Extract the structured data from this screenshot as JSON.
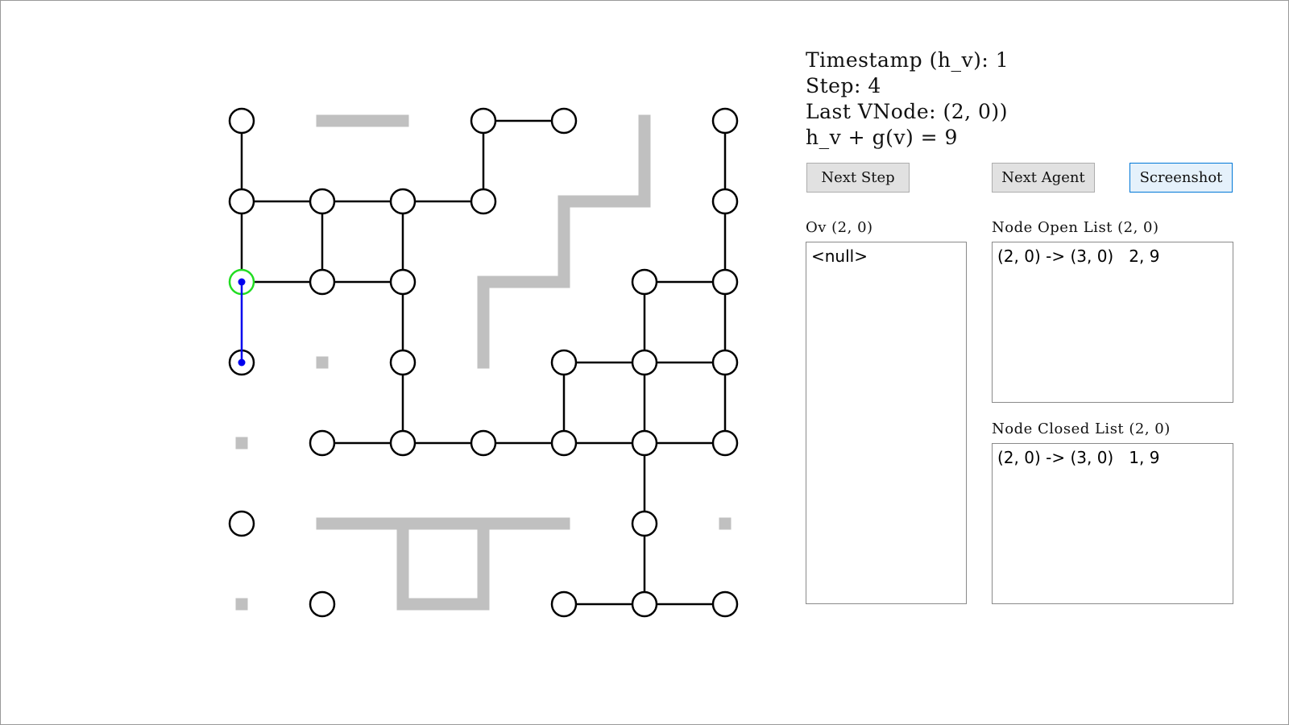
{
  "info": {
    "timestamp": "Timestamp (h_v): 1",
    "step": "Step: 4",
    "last_vnode": "Last VNode: (2, 0))",
    "hv_gv": "h_v + g(v) = 9"
  },
  "buttons": {
    "next_step": "Next Step",
    "next_agent": "Next Agent",
    "screenshot": "Screenshot"
  },
  "ov_list": {
    "label": "Ov (2, 0)",
    "items": [
      "<null>"
    ]
  },
  "open_list": {
    "label": "Node Open List (2, 0)",
    "items": [
      "(2, 0) -> (3, 0)   2, 9"
    ]
  },
  "closed_list": {
    "label": "Node Closed List (2, 0)",
    "items": [
      "(2, 0) -> (3, 0)   1, 9"
    ]
  },
  "colors": {
    "node_stroke": "#000000",
    "edge": "#000000",
    "wall": "#c0c0c0",
    "current_node_ring": "#22dd22",
    "path": "#0000ee"
  },
  "grid": {
    "rows": 7,
    "cols": 7,
    "nodes": [
      [
        0,
        0
      ],
      [
        0,
        3
      ],
      [
        0,
        4
      ],
      [
        0,
        6
      ],
      [
        1,
        0
      ],
      [
        1,
        1
      ],
      [
        1,
        2
      ],
      [
        1,
        3
      ],
      [
        1,
        6
      ],
      [
        2,
        0
      ],
      [
        2,
        1
      ],
      [
        2,
        2
      ],
      [
        2,
        5
      ],
      [
        2,
        6
      ],
      [
        3,
        0
      ],
      [
        3,
        2
      ],
      [
        3,
        4
      ],
      [
        3,
        5
      ],
      [
        3,
        6
      ],
      [
        4,
        1
      ],
      [
        4,
        2
      ],
      [
        4,
        3
      ],
      [
        4,
        4
      ],
      [
        4,
        5
      ],
      [
        4,
        6
      ],
      [
        5,
        0
      ],
      [
        5,
        5
      ],
      [
        6,
        1
      ],
      [
        6,
        4
      ],
      [
        6,
        5
      ],
      [
        6,
        6
      ]
    ],
    "edges": [
      [
        [
          0,
          0
        ],
        [
          1,
          0
        ]
      ],
      [
        [
          1,
          0
        ],
        [
          2,
          0
        ]
      ],
      [
        [
          0,
          3
        ],
        [
          0,
          4
        ]
      ],
      [
        [
          0,
          3
        ],
        [
          1,
          3
        ]
      ],
      [
        [
          0,
          6
        ],
        [
          1,
          6
        ]
      ],
      [
        [
          1,
          6
        ],
        [
          2,
          6
        ]
      ],
      [
        [
          2,
          6
        ],
        [
          3,
          6
        ]
      ],
      [
        [
          3,
          6
        ],
        [
          4,
          6
        ]
      ],
      [
        [
          1,
          0
        ],
        [
          1,
          1
        ]
      ],
      [
        [
          1,
          1
        ],
        [
          1,
          2
        ]
      ],
      [
        [
          1,
          2
        ],
        [
          1,
          3
        ]
      ],
      [
        [
          1,
          1
        ],
        [
          2,
          1
        ]
      ],
      [
        [
          1,
          2
        ],
        [
          2,
          2
        ]
      ],
      [
        [
          2,
          0
        ],
        [
          2,
          1
        ]
      ],
      [
        [
          2,
          1
        ],
        [
          2,
          2
        ]
      ],
      [
        [
          2,
          2
        ],
        [
          3,
          2
        ]
      ],
      [
        [
          3,
          2
        ],
        [
          4,
          2
        ]
      ],
      [
        [
          2,
          5
        ],
        [
          2,
          6
        ]
      ],
      [
        [
          2,
          5
        ],
        [
          3,
          5
        ]
      ],
      [
        [
          3,
          5
        ],
        [
          4,
          5
        ]
      ],
      [
        [
          3,
          4
        ],
        [
          3,
          5
        ]
      ],
      [
        [
          3,
          5
        ],
        [
          3,
          6
        ]
      ],
      [
        [
          3,
          4
        ],
        [
          4,
          4
        ]
      ],
      [
        [
          4,
          1
        ],
        [
          4,
          2
        ]
      ],
      [
        [
          4,
          2
        ],
        [
          4,
          3
        ]
      ],
      [
        [
          4,
          3
        ],
        [
          4,
          4
        ]
      ],
      [
        [
          4,
          4
        ],
        [
          4,
          5
        ]
      ],
      [
        [
          4,
          5
        ],
        [
          4,
          6
        ]
      ],
      [
        [
          4,
          5
        ],
        [
          5,
          5
        ]
      ],
      [
        [
          5,
          5
        ],
        [
          6,
          5
        ]
      ],
      [
        [
          6,
          4
        ],
        [
          6,
          5
        ]
      ],
      [
        [
          6,
          5
        ],
        [
          6,
          6
        ]
      ]
    ],
    "walls_h": [
      {
        "row": 0,
        "from": 1,
        "to": 2
      },
      {
        "row": 2,
        "from": 3,
        "to": 4
      },
      {
        "row": 1,
        "from": 4,
        "to": 5
      },
      {
        "row": 5,
        "from": 1,
        "to": 4
      },
      {
        "row": 6,
        "from": 2,
        "to": 3
      }
    ],
    "walls_v": [
      {
        "col": 5,
        "from": 0,
        "to": 1
      },
      {
        "col": 4,
        "from": 1,
        "to": 2
      },
      {
        "col": 3,
        "from": 2,
        "to": 3
      },
      {
        "col": 2,
        "from": 5,
        "to": 6
      },
      {
        "col": 3,
        "from": 5,
        "to": 6
      }
    ],
    "wall_dots": [
      [
        3,
        1
      ],
      [
        4,
        0
      ],
      [
        5,
        6
      ],
      [
        6,
        0
      ]
    ],
    "current_node": [
      2,
      0
    ],
    "path": [
      [
        2,
        0
      ],
      [
        3,
        0
      ]
    ]
  }
}
